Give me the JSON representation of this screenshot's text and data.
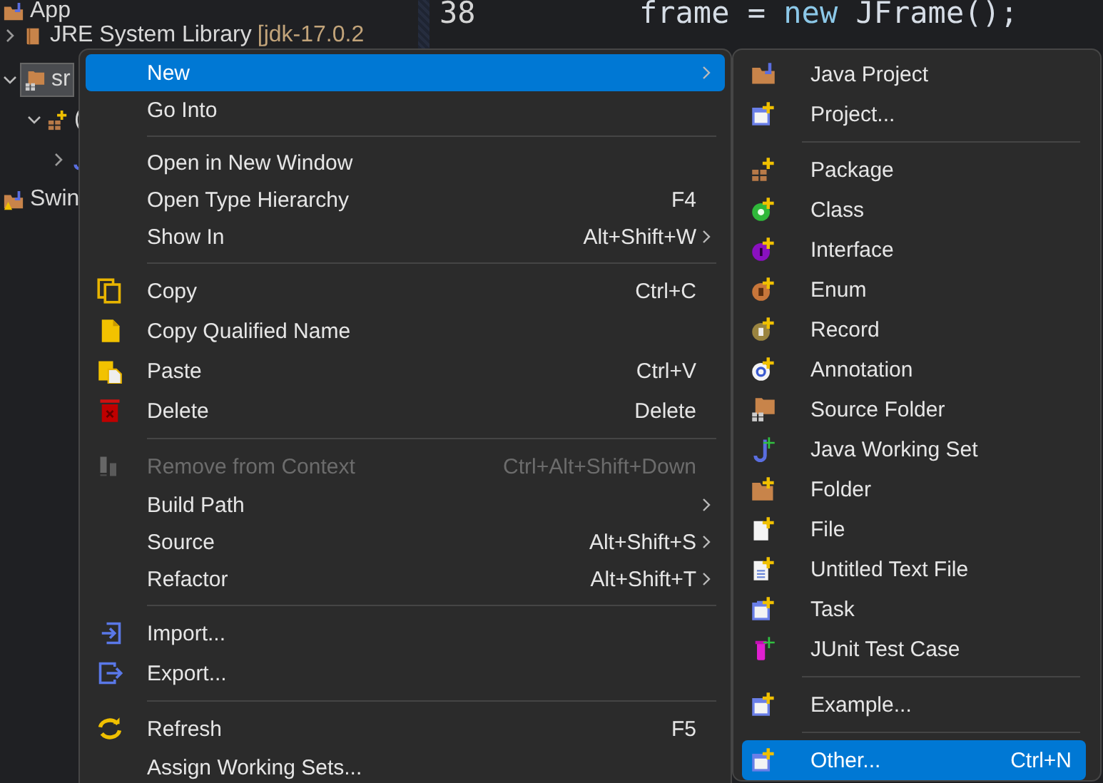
{
  "explorer": {
    "tree": [
      {
        "label": "App",
        "children": [
          {
            "label": "JRE System Library",
            "decoration": "[jdk-17.0.2",
            "expanded": false,
            "selected": false
          },
          {
            "label": "sr",
            "expanded": true,
            "selected": true,
            "children": [
              {
                "label": "(",
                "expanded": true,
                "selected": false,
                "children": [
                  {
                    "expanded": false,
                    "selected": false
                  }
                ]
              }
            ]
          }
        ],
        "selected": false
      },
      {
        "label": "Swin",
        "selected": false
      }
    ]
  },
  "editor": {
    "lines": [
      {
        "number": "38",
        "tokens": [
          {
            "text": "frame = ",
            "kind": "plain"
          },
          {
            "text": "new",
            "kind": "keyword"
          },
          {
            "text": " JFrame();",
            "kind": "plain"
          }
        ]
      }
    ]
  },
  "context_menu": {
    "items": [
      {
        "kind": "item",
        "label": "New",
        "submenu": true,
        "selected": true,
        "disabled": false
      },
      {
        "kind": "item",
        "label": "Go Into",
        "submenu": false,
        "selected": false,
        "disabled": false
      },
      {
        "kind": "separator"
      },
      {
        "kind": "item",
        "label": "Open in New Window",
        "submenu": false,
        "selected": false,
        "disabled": false
      },
      {
        "kind": "item",
        "label": "Open Type Hierarchy",
        "shortcut": "F4",
        "submenu": false,
        "selected": false,
        "disabled": false
      },
      {
        "kind": "item",
        "label": "Show In",
        "shortcut": "Alt+Shift+W",
        "submenu": true,
        "selected": false,
        "disabled": false
      },
      {
        "kind": "separator"
      },
      {
        "kind": "item",
        "label": "Copy",
        "shortcut": "Ctrl+C",
        "submenu": false,
        "selected": false,
        "disabled": false
      },
      {
        "kind": "item",
        "label": "Copy Qualified Name",
        "submenu": false,
        "selected": false,
        "disabled": false
      },
      {
        "kind": "item",
        "label": "Paste",
        "shortcut": "Ctrl+V",
        "submenu": false,
        "selected": false,
        "disabled": false
      },
      {
        "kind": "item",
        "label": "Delete",
        "shortcut": "Delete",
        "submenu": false,
        "selected": false,
        "disabled": false
      },
      {
        "kind": "separator"
      },
      {
        "kind": "item",
        "label": "Remove from Context",
        "shortcut": "Ctrl+Alt+Shift+Down",
        "submenu": false,
        "selected": false,
        "disabled": true
      },
      {
        "kind": "item",
        "label": "Build Path",
        "submenu": true,
        "selected": false,
        "disabled": false
      },
      {
        "kind": "item",
        "label": "Source",
        "shortcut": "Alt+Shift+S",
        "submenu": true,
        "selected": false,
        "disabled": false
      },
      {
        "kind": "item",
        "label": "Refactor",
        "shortcut": "Alt+Shift+T",
        "submenu": true,
        "selected": false,
        "disabled": false
      },
      {
        "kind": "separator"
      },
      {
        "kind": "item",
        "label": "Import...",
        "submenu": false,
        "selected": false,
        "disabled": false
      },
      {
        "kind": "item",
        "label": "Export...",
        "submenu": false,
        "selected": false,
        "disabled": false
      },
      {
        "kind": "separator"
      },
      {
        "kind": "item",
        "label": "Refresh",
        "shortcut": "F5",
        "submenu": false,
        "selected": false,
        "disabled": false
      },
      {
        "kind": "item",
        "label": "Assign Working Sets...",
        "submenu": false,
        "selected": false,
        "disabled": false
      }
    ]
  },
  "new_submenu": {
    "items": [
      {
        "kind": "item",
        "label": "Java Project",
        "selected": false
      },
      {
        "kind": "item",
        "label": "Project...",
        "selected": false
      },
      {
        "kind": "separator"
      },
      {
        "kind": "item",
        "label": "Package",
        "selected": false
      },
      {
        "kind": "item",
        "label": "Class",
        "selected": false
      },
      {
        "kind": "item",
        "label": "Interface",
        "selected": false
      },
      {
        "kind": "item",
        "label": "Enum",
        "selected": false
      },
      {
        "kind": "item",
        "label": "Record",
        "selected": false
      },
      {
        "kind": "item",
        "label": "Annotation",
        "selected": false
      },
      {
        "kind": "item",
        "label": "Source Folder",
        "selected": false
      },
      {
        "kind": "item",
        "label": "Java Working Set",
        "selected": false
      },
      {
        "kind": "item",
        "label": "Folder",
        "selected": false
      },
      {
        "kind": "item",
        "label": "File",
        "selected": false
      },
      {
        "kind": "item",
        "label": "Untitled Text File",
        "selected": false
      },
      {
        "kind": "item",
        "label": "Task",
        "selected": false
      },
      {
        "kind": "item",
        "label": "JUnit Test Case",
        "selected": false
      },
      {
        "kind": "separator"
      },
      {
        "kind": "item",
        "label": "Example...",
        "selected": false
      },
      {
        "kind": "separator"
      },
      {
        "kind": "item",
        "label": "Other...",
        "shortcut": "Ctrl+N",
        "selected": true
      }
    ]
  }
}
